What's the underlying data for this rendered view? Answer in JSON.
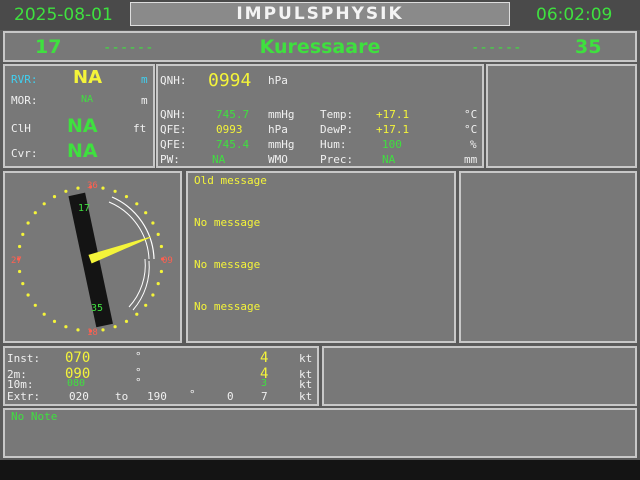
{
  "header": {
    "date": "2025-08-01",
    "title": "IMPULSPHYSIK",
    "time": "06:02:09"
  },
  "runway": {
    "left": "17",
    "left_dash": "------",
    "station": "Kuressaare",
    "right_dash": "------",
    "right": "35"
  },
  "visibility": {
    "rvr_label": "RVR:",
    "rvr_value": "NA",
    "rvr_unit": "m",
    "mor_label": "MOR:",
    "mor_value": "NA",
    "mor_unit": "m",
    "clh_label": "ClH",
    "clh_value": "NA",
    "clh_unit": "ft",
    "cvr_label": "Cvr:",
    "cvr_value": "NA"
  },
  "pressure": {
    "qnh_label": "QNH:",
    "qnh_big": "0994",
    "qnh_big_unit": "hPa",
    "rows": [
      {
        "l1": "QNH:",
        "v1": "745.7",
        "u1": "mmHg",
        "l2": "Temp:",
        "v2": "+17.1",
        "u2": "°C"
      },
      {
        "l1": "QFE:",
        "v1": "0993",
        "u1": "hPa",
        "l2": "DewP:",
        "v2": "+17.1",
        "u2": "°C"
      },
      {
        "l1": "QFE:",
        "v1": "745.4",
        "u1": "mmHg",
        "l2": "Hum:",
        "v2": "100",
        "u2": "%"
      },
      {
        "l1": "PW:",
        "v1": "NA",
        "u1": "WMO",
        "l2": "Prec:",
        "v2": "NA",
        "u2": "mm"
      }
    ]
  },
  "compass": {
    "n": "36",
    "e": "09",
    "s": "18",
    "w": "27",
    "rwy_top": "17",
    "rwy_bottom": "35",
    "wind_dir_deg": 70
  },
  "messages": {
    "title": "Old message",
    "items": [
      "No message",
      "No message",
      "No message"
    ]
  },
  "wind": {
    "inst_label": "Inst:",
    "inst_dir": "070",
    "inst_deg": "°",
    "inst_speed": "4",
    "inst_unit": "kt",
    "m2_label": "2m:",
    "m2_dir": "090",
    "m2_deg": "°",
    "m2_speed": "4",
    "m2_unit": "kt",
    "m10_label": "10m:",
    "m10_dir": "080",
    "m10_deg": "°",
    "m10_speed": "3",
    "m10_unit": "kt",
    "extr_label": "Extr:",
    "extr_from": "020",
    "extr_to_word": "to",
    "extr_to": "190",
    "extr_deg": "°",
    "extr_min": "0",
    "extr_max": "7",
    "extr_unit": "kt"
  },
  "note": {
    "text": "No Note"
  },
  "colors": {
    "green": "#3fe03f",
    "yellow": "#f4f43a",
    "cyan": "#40d0f0",
    "red": "#ff6050",
    "panel": "#787878"
  }
}
